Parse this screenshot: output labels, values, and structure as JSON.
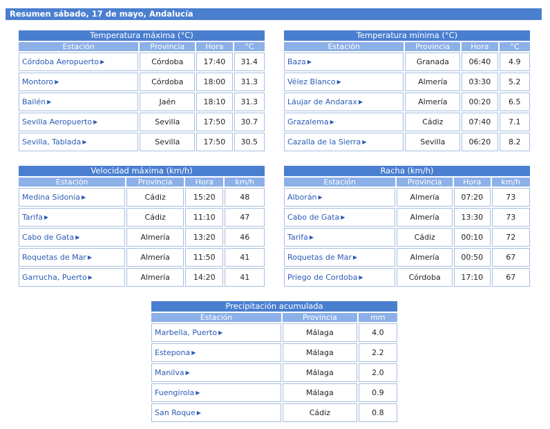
{
  "header": {
    "title": "Resumen sábado, 17 de mayo, Andalucía"
  },
  "tables": [
    {
      "caption": "Temperatura máxima (°C)",
      "columns": [
        "Estación",
        "Provincia",
        "Hora",
        "°C"
      ],
      "rows": [
        [
          "Córdoba Aeropuerto",
          "Córdoba",
          "17:40",
          "31.4"
        ],
        [
          "Montoro",
          "Córdoba",
          "18:00",
          "31.3"
        ],
        [
          "Bailén",
          "Jaén",
          "18:10",
          "31.3"
        ],
        [
          "Sevilla Aeropuerto",
          "Sevilla",
          "17:50",
          "30.7"
        ],
        [
          "Sevilla, Tablada",
          "Sevilla",
          "17:50",
          "30.5"
        ]
      ]
    },
    {
      "caption": "Temperatura mínima (°C)",
      "columns": [
        "Estación",
        "Provincia",
        "Hora",
        "°C"
      ],
      "rows": [
        [
          "Baza",
          "Granada",
          "06:40",
          "4.9"
        ],
        [
          "Vélez Blanco",
          "Almería",
          "03:30",
          "5.2"
        ],
        [
          "Láujar de Andarax",
          "Almería",
          "00:20",
          "6.5"
        ],
        [
          "Grazalema",
          "Cádiz",
          "07:40",
          "7.1"
        ],
        [
          "Cazalla de la Sierra",
          "Sevilla",
          "06:20",
          "8.2"
        ]
      ]
    },
    {
      "caption": "Velocidad máxima (km/h)",
      "columns": [
        "Estación",
        "Provincia",
        "Hora",
        "km/h"
      ],
      "rows": [
        [
          "Medina Sidonia",
          "Cádiz",
          "15:20",
          "48"
        ],
        [
          "Tarifa",
          "Cádiz",
          "11:10",
          "47"
        ],
        [
          "Cabo de Gata",
          "Almería",
          "13:20",
          "46"
        ],
        [
          "Roquetas de Mar",
          "Almería",
          "11:50",
          "41"
        ],
        [
          "Garrucha, Puerto",
          "Almería",
          "14:20",
          "41"
        ]
      ]
    },
    {
      "caption": "Racha (km/h)",
      "columns": [
        "Estación",
        "Provincia",
        "Hora",
        "km/h"
      ],
      "rows": [
        [
          "Alborán",
          "Almería",
          "07:20",
          "73"
        ],
        [
          "Cabo de Gata",
          "Almería",
          "13:30",
          "73"
        ],
        [
          "Tarifa",
          "Cádiz",
          "00:10",
          "72"
        ],
        [
          "Roquetas de Mar",
          "Almería",
          "00:50",
          "67"
        ],
        [
          "Priego de Cordoba",
          "Córdoba",
          "17:10",
          "67"
        ]
      ]
    },
    {
      "caption": "Precipitación acumulada",
      "columns": [
        "Estación",
        "Provincia",
        "mm"
      ],
      "rows": [
        [
          "Marbella, Puerto",
          "Málaga",
          "4.0"
        ],
        [
          "Estepona",
          "Málaga",
          "2.2"
        ],
        [
          "Manilva",
          "Málaga",
          "2.0"
        ],
        [
          "Fuengirola",
          "Málaga",
          "0.9"
        ],
        [
          "San Roque",
          "Cádiz",
          "0.8"
        ]
      ]
    }
  ],
  "icons": {
    "station_link": "triangle-right-icon"
  },
  "colors": {
    "header_bg": "#4a7fd0",
    "column_header_bg": "#8cb0e8",
    "link": "#2a5ab5",
    "cell_border": "#a6bde0"
  }
}
